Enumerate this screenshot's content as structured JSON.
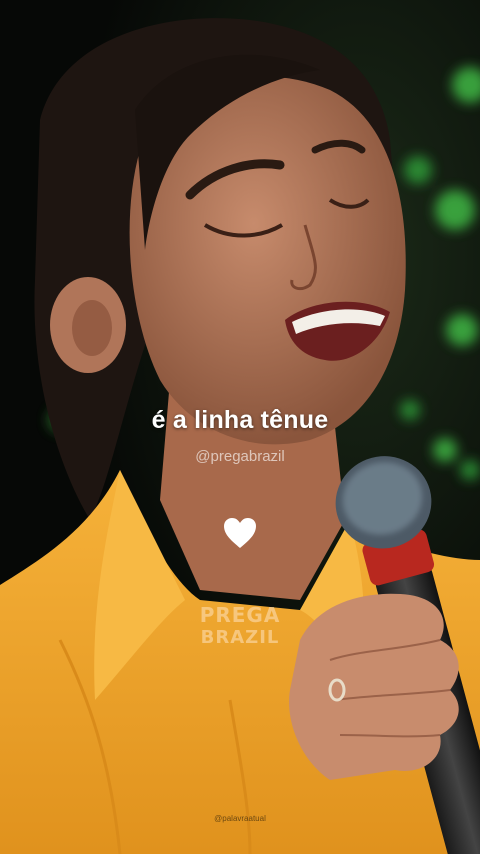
{
  "video": {
    "caption": "é a linha tênue",
    "handle": "@pregabrazil",
    "watermark_line1": "PREGA",
    "watermark_line2": "BRAZIL",
    "footer_credit": "@palavraatual",
    "heart_icon": "heart-icon",
    "colors": {
      "shirt": "#f0a62a",
      "background": "#0b0f0b",
      "bokeh": "#3fb845",
      "text": "#ffffff"
    }
  }
}
